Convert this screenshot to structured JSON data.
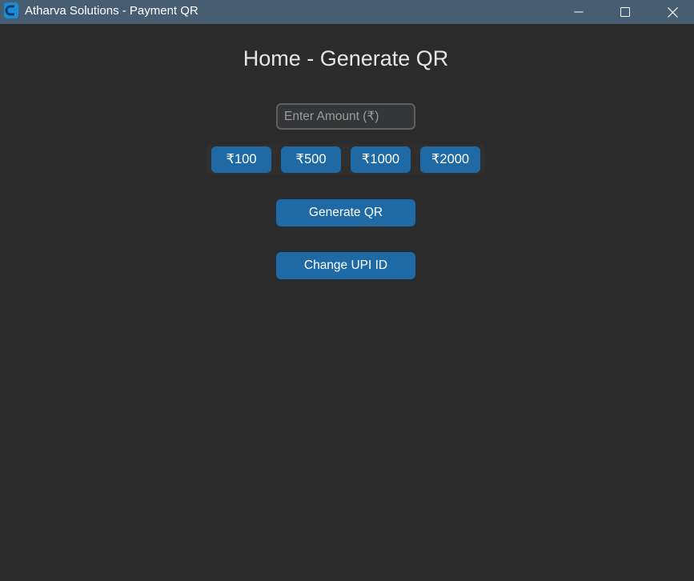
{
  "window": {
    "title": "Atharva Solutions - Payment QR",
    "app_icon": "app-icon",
    "controls": [
      "minimize-icon",
      "maximize-icon",
      "close-icon"
    ]
  },
  "page": {
    "title": "Home - Generate QR"
  },
  "amount_input": {
    "placeholder": "Enter Amount (₹)",
    "value": ""
  },
  "presets": [
    {
      "label": "₹100"
    },
    {
      "label": "₹500"
    },
    {
      "label": "₹1000"
    },
    {
      "label": "₹2000"
    }
  ],
  "actions": {
    "generate_label": "Generate QR",
    "change_upi_label": "Change UPI ID"
  },
  "colors": {
    "titlebar": "#475e72",
    "background": "#2b2b2b",
    "accent": "#1f6aa5"
  }
}
